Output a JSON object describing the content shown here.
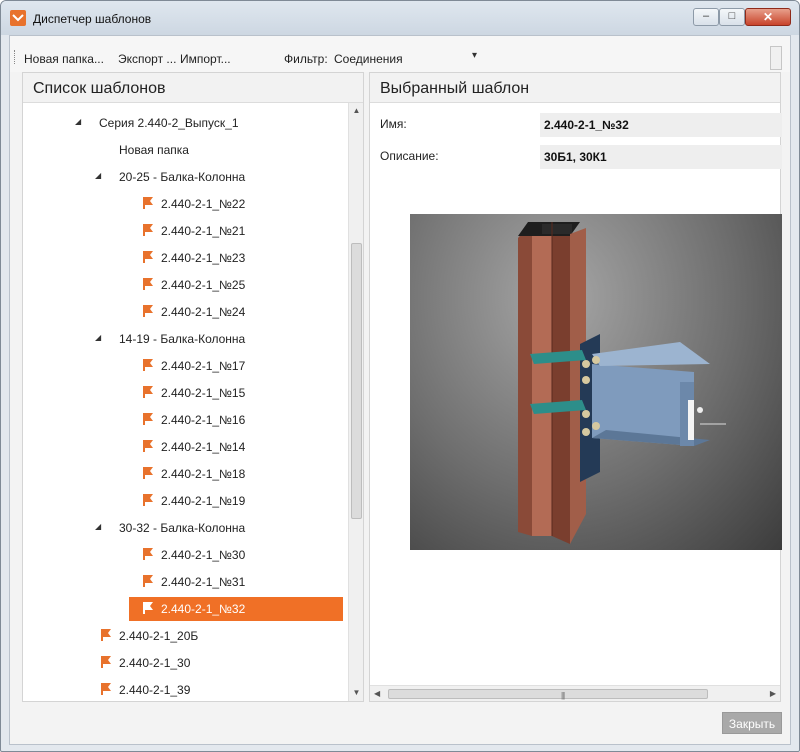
{
  "window": {
    "title": "Диспетчер шаблонов",
    "controls": {
      "minimize": "–",
      "maximize": "□",
      "close": "✕"
    }
  },
  "toolbar": {
    "new_folder": "Новая папка...",
    "export": "Экспорт ...",
    "import": "Импорт...",
    "filter_label": "Фильтр:",
    "filter_value": "Соединения",
    "filter_dropdown_icon": "▾"
  },
  "left_panel": {
    "title": "Список шаблонов",
    "tree": [
      {
        "label": "Серия 2.440-2_Выпуск_1",
        "type": "group",
        "expanded": true
      },
      {
        "label": "Новая папка",
        "type": "folder"
      },
      {
        "label": "20-25 - Балка-Колонна",
        "type": "group",
        "expanded": true
      },
      {
        "label": "2.440-2-1_№22",
        "type": "template"
      },
      {
        "label": "2.440-2-1_№21",
        "type": "template"
      },
      {
        "label": "2.440-2-1_№23",
        "type": "template"
      },
      {
        "label": "2.440-2-1_№25",
        "type": "template"
      },
      {
        "label": "2.440-2-1_№24",
        "type": "template"
      },
      {
        "label": "14-19 - Балка-Колонна",
        "type": "group",
        "expanded": true
      },
      {
        "label": "2.440-2-1_№17",
        "type": "template"
      },
      {
        "label": "2.440-2-1_№15",
        "type": "template"
      },
      {
        "label": "2.440-2-1_№16",
        "type": "template"
      },
      {
        "label": "2.440-2-1_№14",
        "type": "template"
      },
      {
        "label": "2.440-2-1_№18",
        "type": "template"
      },
      {
        "label": "2.440-2-1_№19",
        "type": "template"
      },
      {
        "label": "30-32 - Балка-Колонна",
        "type": "group",
        "expanded": true
      },
      {
        "label": "2.440-2-1_№30",
        "type": "template"
      },
      {
        "label": "2.440-2-1_№31",
        "type": "template"
      },
      {
        "label": "2.440-2-1_№32",
        "type": "template",
        "selected": true
      },
      {
        "label": "2.440-2-1_20Б",
        "type": "template"
      },
      {
        "label": "2.440-2-1_30",
        "type": "template"
      },
      {
        "label": "2.440-2-1_39",
        "type": "template"
      }
    ]
  },
  "right_panel": {
    "title": "Выбранный шаблон",
    "name_label": "Имя:",
    "name_value": "2.440-2-1_№32",
    "description_label": "Описание:",
    "description_value": "30Б1, 30К1",
    "preview_icon": "beam-column-connection-3d-icon"
  },
  "footer": {
    "close_button": "Закрыть"
  },
  "colors": {
    "accent": "#f07026",
    "template_icon": "#e8722c",
    "column": "#b06a52",
    "beam": "#8aa2bf"
  }
}
